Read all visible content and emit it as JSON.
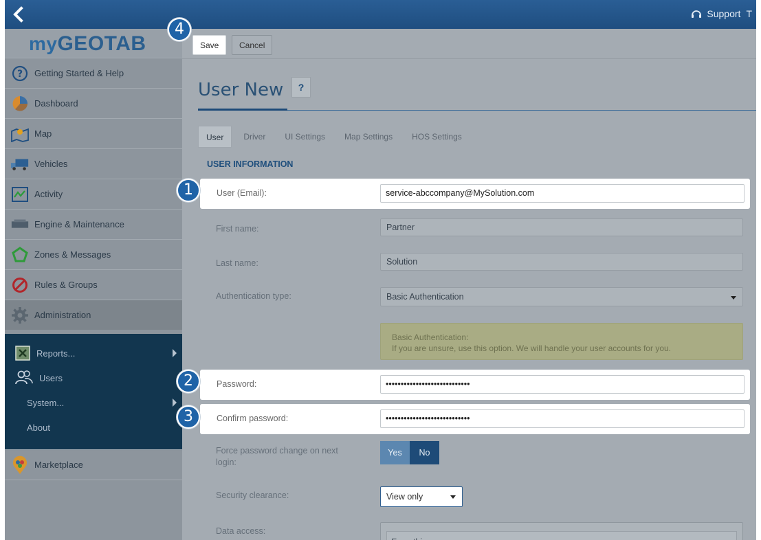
{
  "topbar": {
    "support_label": "Support",
    "trailing_label": "T"
  },
  "logo": {
    "text_my": "my",
    "text_brand": "GEOTAB"
  },
  "sidebar": {
    "items": [
      {
        "label": "Getting Started & Help",
        "icon": "help-circle-icon"
      },
      {
        "label": "Dashboard",
        "icon": "pie-chart-icon"
      },
      {
        "label": "Map",
        "icon": "map-pin-icon"
      },
      {
        "label": "Vehicles",
        "icon": "truck-icon"
      },
      {
        "label": "Activity",
        "icon": "activity-chart-icon"
      },
      {
        "label": "Engine & Maintenance",
        "icon": "engine-icon"
      },
      {
        "label": "Zones & Messages",
        "icon": "zone-polygon-icon"
      },
      {
        "label": "Rules & Groups",
        "icon": "prohibited-icon"
      },
      {
        "label": "Administration",
        "icon": "gear-icon"
      },
      {
        "label": "Marketplace",
        "icon": "marketplace-pin-icon"
      }
    ],
    "submenu": [
      {
        "label": "Reports...",
        "icon": "excel-icon"
      },
      {
        "label": "Users",
        "icon": "users-icon"
      },
      {
        "label": "System...",
        "icon": ""
      },
      {
        "label": "About",
        "icon": ""
      }
    ]
  },
  "toolbar": {
    "save_label": "Save",
    "cancel_label": "Cancel"
  },
  "page": {
    "title": "User New",
    "help_label": "?"
  },
  "tabs": [
    "User",
    "Driver",
    "UI Settings",
    "Map Settings",
    "HOS Settings"
  ],
  "form": {
    "section_title": "USER INFORMATION",
    "email_label": "User (Email):",
    "email_value": "service-abccompany@MySolution.com",
    "first_name_label": "First name:",
    "first_name_value": "Partner",
    "last_name_label": "Last name:",
    "last_name_value": "Solution",
    "auth_type_label": "Authentication type:",
    "auth_type_value": "Basic Authentication",
    "auth_note_title": "Basic Authentication:",
    "auth_note_text": "If you are unsure, use this option. We will handle your user accounts for you.",
    "password_label": "Password:",
    "password_value": "••••••••••••••••••••••••••••",
    "confirm_password_label": "Confirm password:",
    "confirm_password_value": "••••••••••••••••••••••••••••",
    "force_change_label": "Force password change on next login:",
    "yes_label": "Yes",
    "no_label": "No",
    "security_label": "Security clearance:",
    "security_value": "View only",
    "data_access_label": "Data access:",
    "data_access_value": "Everything"
  },
  "badges": {
    "b1": "1",
    "b2": "2",
    "b3": "3",
    "b4": "4"
  },
  "colors": {
    "brand_blue": "#1f4e80",
    "badge_blue": "#1f63a7",
    "submenu_bg": "#12364f"
  }
}
